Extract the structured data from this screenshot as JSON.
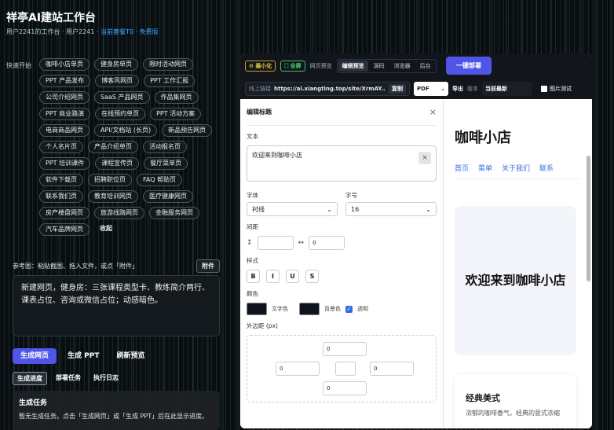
{
  "header": {
    "title": "祥亭AI建站工作台",
    "subtitle_prefix": "用户2241的工作台 · 用户2241 · ",
    "subtitle_highlight": "当前套餐T0 · 免费版"
  },
  "templates": {
    "label": "快速开始",
    "chips": [
      "咖啡小店单页",
      "健身房单页",
      "限时活动网页",
      "PPT 产品发布",
      "博客风网页",
      "PPT 工作汇报",
      "公司介绍网页",
      "SaaS 产品网页",
      "作品集网页",
      "PPT 商业路演",
      "在线预约单页",
      "PPT 活动方案",
      "电商商品网页",
      "API/文档站 (长页)",
      "新品预告网页",
      "个人名片页",
      "产品介绍单页",
      "活动报名页",
      "PPT 培训课件",
      "课程宣传页",
      "餐厅菜单页",
      "软件下载页",
      "招聘职位页",
      "FAQ 帮助页",
      "联系我们页",
      "教育培训网页",
      "医疗健康网页",
      "房产楼盘网页",
      "旅游线路网页",
      "金融服务网页",
      "汽车品牌网页"
    ],
    "collapse": "收起"
  },
  "reference": {
    "label": "参考图：粘贴截图、拖入文件，或点「附件」",
    "attach": "附件"
  },
  "prompt": {
    "text": "新建网页，健身房：三张课程类型卡、教练简介两行、课表占位、咨询或微信占位；动感暗色。"
  },
  "actions": {
    "gen_web": "生成网页",
    "gen_ppt": "生成 PPT",
    "refresh": "刷新预览"
  },
  "bottom_tabs": {
    "progress": "生成进度",
    "deploy": "部署任务",
    "log": "执行日志"
  },
  "task": {
    "title": "生成任务",
    "text": "暂无生成任务。点击「生成网页」或「生成 PPT」后在此显示进度。"
  },
  "toolbar": {
    "minimize": "最小化",
    "fullscreen": "全屏",
    "web_preview": "网页预览",
    "seg": [
      "编辑预览",
      "源码",
      "浏览器",
      "后台"
    ],
    "deploy": "一键部署"
  },
  "toolbar2": {
    "url_label": "线上链接",
    "url": "https://ai.xiangting.top/site/XrmAY...",
    "copy": "复制",
    "format": "PDF",
    "export": "导出",
    "version_label": "版本",
    "version": "当前最新",
    "img_test": "图片测试"
  },
  "editor": {
    "title": "编辑标题",
    "close": "×",
    "text_label": "文本",
    "text_value": "欢迎来到咖啡小店",
    "font_label": "字体",
    "font_value": "衬线",
    "size_label": "字号",
    "size_value": "16",
    "spacing_label": "间距",
    "spacing_value": "0",
    "style_label": "样式",
    "styles": [
      "B",
      "I",
      "U",
      "S"
    ],
    "color_label": "颜色",
    "text_color": "文字色",
    "bg_color": "背景色",
    "transparent": "透明",
    "margin_label": "外边距 (px)",
    "margin_top": "0",
    "margin_left": "0",
    "margin_right": "0",
    "margin_bottom": "0"
  },
  "preview": {
    "brand": "咖啡小店",
    "nav": [
      "首页",
      "菜单",
      "关于我们",
      "联系"
    ],
    "hero": "欢迎来到咖啡小店",
    "card_title": "经典美式",
    "card_desc": "浓郁的咖啡香气，经典的意式浓缩"
  }
}
